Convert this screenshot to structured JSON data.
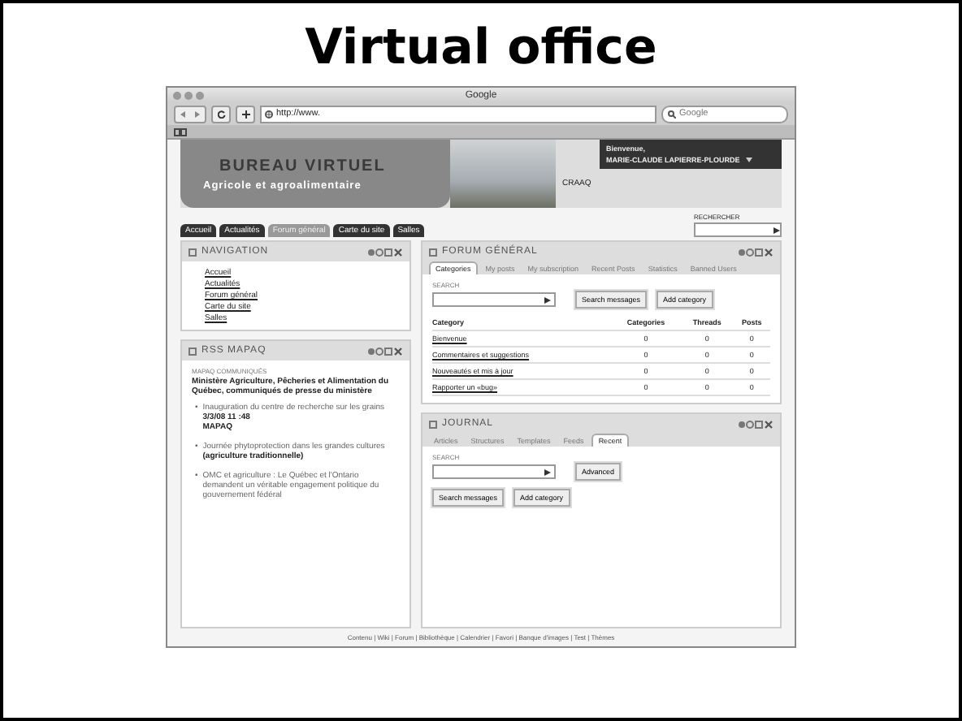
{
  "slide": {
    "title": "Virtual office"
  },
  "browser": {
    "title": "Google",
    "url": "http://www.",
    "search_placeholder": "Google"
  },
  "banner": {
    "title": "BUREAU VIRTUEL",
    "subtitle": "Agricole et agroalimentaire",
    "org": "CRAAQ",
    "welcome": "Bienvenue,",
    "user": "MARIE-CLAUDE LAPIERRE-PLOURDE"
  },
  "nav_tabs": [
    {
      "label": "Accueil",
      "selected": false
    },
    {
      "label": "Actualités",
      "selected": false
    },
    {
      "label": "Forum général",
      "selected": true
    },
    {
      "label": "Carte du site",
      "selected": false
    },
    {
      "label": "Salles",
      "selected": false
    }
  ],
  "site_search": {
    "label": "RECHERCHER"
  },
  "navigation": {
    "title": "NAVIGATION",
    "links": [
      "Accueil",
      "Actualités",
      "Forum général",
      "Carte du site",
      "Salles"
    ]
  },
  "rss": {
    "title": "RSS MAPAQ",
    "label": "MAPAQ COMMUNIQUÉS",
    "heading": "Ministère Agriculture, Pêcheries et Alimentation du Québec, communiqués de presse du ministère",
    "items": [
      {
        "marker": "•",
        "link": "Inauguration du centre de recherche sur les grains",
        "meta": [
          "3/3/08 11 :48",
          "MAPAQ"
        ]
      },
      {
        "marker": "•",
        "link": "Journée phytoprotection dans les grandes cultures",
        "note": "(agriculture traditionnelle)"
      },
      {
        "marker": "•",
        "link": "OMC et agriculture : Le Québec et l'Ontario demandent un véritable engagement politique du gouvernement fédéral"
      }
    ]
  },
  "forum": {
    "title": "FORUM GÉNÉRAL",
    "tabs": [
      {
        "label": "Categories",
        "selected": true
      },
      {
        "label": "My posts",
        "selected": false
      },
      {
        "label": "My subscription",
        "selected": false
      },
      {
        "label": "Recent Posts",
        "selected": false
      },
      {
        "label": "Statistics",
        "selected": false
      },
      {
        "label": "Banned Users",
        "selected": false
      }
    ],
    "search_label": "SEARCH",
    "buttons": [
      "Search messages",
      "Add category"
    ],
    "table": {
      "columns": [
        "Category",
        "Categories",
        "Threads",
        "Posts"
      ],
      "rows": [
        [
          "Bienvenue",
          "0",
          "0",
          "0"
        ],
        [
          "Commentaires et suggestions",
          "0",
          "0",
          "0"
        ],
        [
          "Nouveautés et mis à jour",
          "0",
          "0",
          "0"
        ],
        [
          "Rapporter un «bug»",
          "0",
          "0",
          "0"
        ]
      ]
    }
  },
  "journal": {
    "title": "JOURNAL",
    "tabs": [
      {
        "label": "Articles",
        "selected": false
      },
      {
        "label": "Structures",
        "selected": false
      },
      {
        "label": "Templates",
        "selected": false
      },
      {
        "label": "Feeds",
        "selected": false
      },
      {
        "label": "Recent",
        "selected": true
      }
    ],
    "search_label": "SEARCH",
    "advanced": "Advanced",
    "buttons": [
      "Search messages",
      "Add category"
    ]
  },
  "footer": "Contenu | Wiki | Forum | Bibliothèque | Calendrier | Favori | Banque d'images | Test | Thèmes"
}
